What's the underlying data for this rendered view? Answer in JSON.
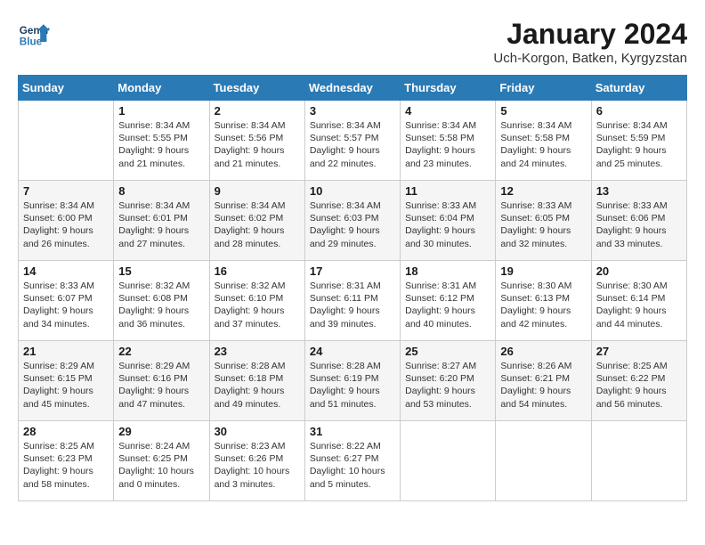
{
  "header": {
    "logo_line1": "General",
    "logo_line2": "Blue",
    "title": "January 2024",
    "subtitle": "Uch-Korgon, Batken, Kyrgyzstan"
  },
  "weekdays": [
    "Sunday",
    "Monday",
    "Tuesday",
    "Wednesday",
    "Thursday",
    "Friday",
    "Saturday"
  ],
  "weeks": [
    [
      {
        "day": "",
        "info": ""
      },
      {
        "day": "1",
        "info": "Sunrise: 8:34 AM\nSunset: 5:55 PM\nDaylight: 9 hours\nand 21 minutes."
      },
      {
        "day": "2",
        "info": "Sunrise: 8:34 AM\nSunset: 5:56 PM\nDaylight: 9 hours\nand 21 minutes."
      },
      {
        "day": "3",
        "info": "Sunrise: 8:34 AM\nSunset: 5:57 PM\nDaylight: 9 hours\nand 22 minutes."
      },
      {
        "day": "4",
        "info": "Sunrise: 8:34 AM\nSunset: 5:58 PM\nDaylight: 9 hours\nand 23 minutes."
      },
      {
        "day": "5",
        "info": "Sunrise: 8:34 AM\nSunset: 5:58 PM\nDaylight: 9 hours\nand 24 minutes."
      },
      {
        "day": "6",
        "info": "Sunrise: 8:34 AM\nSunset: 5:59 PM\nDaylight: 9 hours\nand 25 minutes."
      }
    ],
    [
      {
        "day": "7",
        "info": "Sunrise: 8:34 AM\nSunset: 6:00 PM\nDaylight: 9 hours\nand 26 minutes."
      },
      {
        "day": "8",
        "info": "Sunrise: 8:34 AM\nSunset: 6:01 PM\nDaylight: 9 hours\nand 27 minutes."
      },
      {
        "day": "9",
        "info": "Sunrise: 8:34 AM\nSunset: 6:02 PM\nDaylight: 9 hours\nand 28 minutes."
      },
      {
        "day": "10",
        "info": "Sunrise: 8:34 AM\nSunset: 6:03 PM\nDaylight: 9 hours\nand 29 minutes."
      },
      {
        "day": "11",
        "info": "Sunrise: 8:33 AM\nSunset: 6:04 PM\nDaylight: 9 hours\nand 30 minutes."
      },
      {
        "day": "12",
        "info": "Sunrise: 8:33 AM\nSunset: 6:05 PM\nDaylight: 9 hours\nand 32 minutes."
      },
      {
        "day": "13",
        "info": "Sunrise: 8:33 AM\nSunset: 6:06 PM\nDaylight: 9 hours\nand 33 minutes."
      }
    ],
    [
      {
        "day": "14",
        "info": "Sunrise: 8:33 AM\nSunset: 6:07 PM\nDaylight: 9 hours\nand 34 minutes."
      },
      {
        "day": "15",
        "info": "Sunrise: 8:32 AM\nSunset: 6:08 PM\nDaylight: 9 hours\nand 36 minutes."
      },
      {
        "day": "16",
        "info": "Sunrise: 8:32 AM\nSunset: 6:10 PM\nDaylight: 9 hours\nand 37 minutes."
      },
      {
        "day": "17",
        "info": "Sunrise: 8:31 AM\nSunset: 6:11 PM\nDaylight: 9 hours\nand 39 minutes."
      },
      {
        "day": "18",
        "info": "Sunrise: 8:31 AM\nSunset: 6:12 PM\nDaylight: 9 hours\nand 40 minutes."
      },
      {
        "day": "19",
        "info": "Sunrise: 8:30 AM\nSunset: 6:13 PM\nDaylight: 9 hours\nand 42 minutes."
      },
      {
        "day": "20",
        "info": "Sunrise: 8:30 AM\nSunset: 6:14 PM\nDaylight: 9 hours\nand 44 minutes."
      }
    ],
    [
      {
        "day": "21",
        "info": "Sunrise: 8:29 AM\nSunset: 6:15 PM\nDaylight: 9 hours\nand 45 minutes."
      },
      {
        "day": "22",
        "info": "Sunrise: 8:29 AM\nSunset: 6:16 PM\nDaylight: 9 hours\nand 47 minutes."
      },
      {
        "day": "23",
        "info": "Sunrise: 8:28 AM\nSunset: 6:18 PM\nDaylight: 9 hours\nand 49 minutes."
      },
      {
        "day": "24",
        "info": "Sunrise: 8:28 AM\nSunset: 6:19 PM\nDaylight: 9 hours\nand 51 minutes."
      },
      {
        "day": "25",
        "info": "Sunrise: 8:27 AM\nSunset: 6:20 PM\nDaylight: 9 hours\nand 53 minutes."
      },
      {
        "day": "26",
        "info": "Sunrise: 8:26 AM\nSunset: 6:21 PM\nDaylight: 9 hours\nand 54 minutes."
      },
      {
        "day": "27",
        "info": "Sunrise: 8:25 AM\nSunset: 6:22 PM\nDaylight: 9 hours\nand 56 minutes."
      }
    ],
    [
      {
        "day": "28",
        "info": "Sunrise: 8:25 AM\nSunset: 6:23 PM\nDaylight: 9 hours\nand 58 minutes."
      },
      {
        "day": "29",
        "info": "Sunrise: 8:24 AM\nSunset: 6:25 PM\nDaylight: 10 hours\nand 0 minutes."
      },
      {
        "day": "30",
        "info": "Sunrise: 8:23 AM\nSunset: 6:26 PM\nDaylight: 10 hours\nand 3 minutes."
      },
      {
        "day": "31",
        "info": "Sunrise: 8:22 AM\nSunset: 6:27 PM\nDaylight: 10 hours\nand 5 minutes."
      },
      {
        "day": "",
        "info": ""
      },
      {
        "day": "",
        "info": ""
      },
      {
        "day": "",
        "info": ""
      }
    ]
  ]
}
